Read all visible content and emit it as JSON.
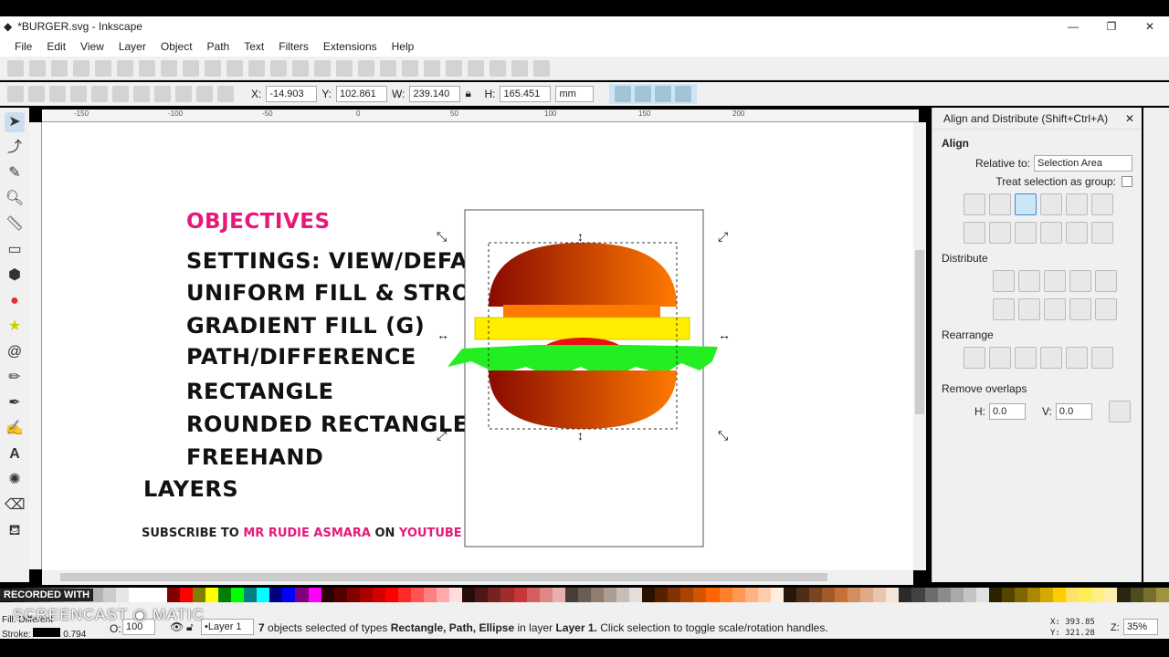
{
  "window": {
    "title": "*BURGER.svg - Inkscape",
    "minimize": "—",
    "maximize": "❐",
    "close": "✕"
  },
  "menu": [
    "File",
    "Edit",
    "View",
    "Layer",
    "Object",
    "Path",
    "Text",
    "Filters",
    "Extensions",
    "Help"
  ],
  "tool_controls": {
    "x_label": "X:",
    "x": "-14.903",
    "y_label": "Y:",
    "y": "102.861",
    "w_label": "W:",
    "w": "239.140",
    "h_label": "H:",
    "h": "165.451",
    "unit": "mm"
  },
  "ruler_ticks": [
    "-150",
    "-100",
    "-50",
    "0",
    "50",
    "100",
    "150",
    "200"
  ],
  "canvas": {
    "heading": "OBJECTIVES",
    "lines": [
      "SETTINGS: VIEW/DEFAULT",
      "UNIFORM FILL & STROKE",
      "GRADIENT FILL (G)",
      "PATH/DIFFERENCE",
      "RECTANGLE",
      "ROUNDED RECTANGLE",
      "FREEHAND",
      "LAYERS"
    ],
    "subscribe": {
      "a": "SUBSCRIBE TO ",
      "b": "MR RUDIE ASMARA",
      "c": " ON ",
      "d": "YOUTUBE"
    },
    "accent": "#e6197a"
  },
  "panel": {
    "title": "Align and Distribute (Shift+Ctrl+A)",
    "align": "Align",
    "relative_label": "Relative to:",
    "relative_value": "Selection Area",
    "group_label": "Treat selection as group:",
    "distribute": "Distribute",
    "rearrange": "Rearrange",
    "remove_overlaps": "Remove overlaps",
    "h_label": "H:",
    "h": "0.0",
    "v_label": "V:",
    "v": "0.0"
  },
  "status": {
    "fill_label": "Fill:",
    "fill_value": "Different",
    "stroke_label": "Stroke:",
    "stroke_value": "0.794",
    "opacity_label": "O:",
    "opacity": "100",
    "layer": "•Layer 1",
    "msg_count": "7",
    "msg_a": " objects selected of types ",
    "types": "Rectangle, Path, Ellipse",
    "msg_b": " in layer ",
    "layer_name": "Layer 1.",
    "msg_c": " Click selection to toggle scale/rotation handles.",
    "x_label": "X:",
    "x": "393.85",
    "y_label": "Y:",
    "y": "321.28",
    "zoom_label": "Z:",
    "zoom": "35%"
  },
  "watermark": {
    "a": "RECORDED WITH",
    "b": "SCREENCAST",
    "c": "MATIC"
  },
  "palette": [
    "#000",
    "#1a1a1a",
    "#333",
    "#4d4d4d",
    "#666",
    "#808080",
    "#999",
    "#b3b3b3",
    "#ccc",
    "#e6e6e6",
    "#fff",
    "#fff",
    "#fff",
    "#800000",
    "#f00",
    "#808000",
    "#ff0",
    "#008000",
    "#0f0",
    "#008080",
    "#0ff",
    "#000080",
    "#00f",
    "#800080",
    "#f0f",
    "#2b0000",
    "#550000",
    "#800000",
    "#aa0000",
    "#d40000",
    "#f00",
    "#ff2a2a",
    "#f55",
    "#ff8080",
    "#faa",
    "#fdd",
    "#280b0b",
    "#501616",
    "#782121",
    "#a02c2c",
    "#c83737",
    "#d35f5f",
    "#de8787",
    "#e9afaf",
    "#483e37",
    "#6c5d53",
    "#917c6f",
    "#ac9d93",
    "#c8beb7",
    "#e3dedb",
    "#2b1100",
    "#552200",
    "#803300",
    "#aa4400",
    "#d45500",
    "#f60",
    "#ff7f2a",
    "#f95",
    "#ffb380",
    "#fca",
    "#fed",
    "#28170b",
    "#502d16",
    "#784421",
    "#a05a2c",
    "#c87137",
    "#d38d5f",
    "#deaa87",
    "#e9c6af",
    "#f4e3d7",
    "#2b2b2b",
    "#424242",
    "#6c6c6c",
    "#8b8b8b",
    "#a9a9a9",
    "#c4c4c4",
    "#e1e1e1",
    "#2b2200",
    "#554400",
    "#806600",
    "#aa8800",
    "#d4aa00",
    "#fc0",
    "#fd2a",
    "#fe5",
    "#fe8",
    "#ffeeaa",
    "#282510",
    "#504a1f",
    "#786e2f",
    "#a0933e"
  ]
}
